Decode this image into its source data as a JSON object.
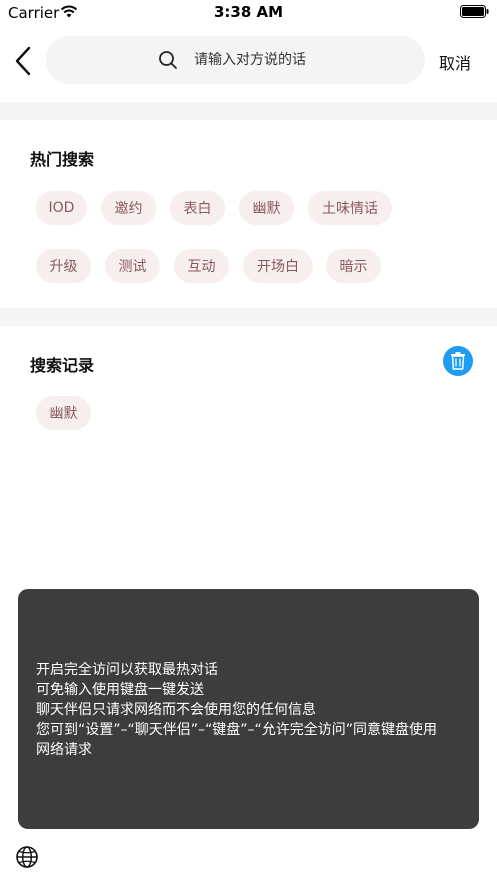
{
  "status_bar": {
    "carrier": "Carrier",
    "time": "3:38 AM"
  },
  "header": {
    "back_icon": "chevron-left-icon",
    "search_icon": "magnifier-icon",
    "search_placeholder": "请输入对方说的话",
    "search_value": "",
    "cancel_label": "取消"
  },
  "hot_search": {
    "title": "热门搜索",
    "tags": [
      "IOD",
      "邀约",
      "表白",
      "幽默",
      "土味情话",
      "升级",
      "测试",
      "互动",
      "开场白",
      "暗示"
    ]
  },
  "history": {
    "title": "搜索记录",
    "clear_icon": "trash-icon",
    "tags": [
      "幽默"
    ]
  },
  "toast": {
    "lines": [
      "开启完全访问以获取最热对话",
      "可免输入使用键盘一键发送",
      "聊天伴侣只请求网络而不会使用您的任何信息",
      "您可到“设置”–“聊天伴侣”–“键盘”–“允许完全访问”同意键盘使用",
      "网络请求"
    ]
  },
  "keyboard": {
    "globe_icon": "globe-icon"
  },
  "colors": {
    "accent": "#1e9cf0",
    "tag_bg": "#f7eeee",
    "tag_text": "#8a5a5c",
    "toast_bg": "#3d3d3d",
    "search_bg": "#f4f4f4",
    "band_bg": "#f5f5f5"
  }
}
